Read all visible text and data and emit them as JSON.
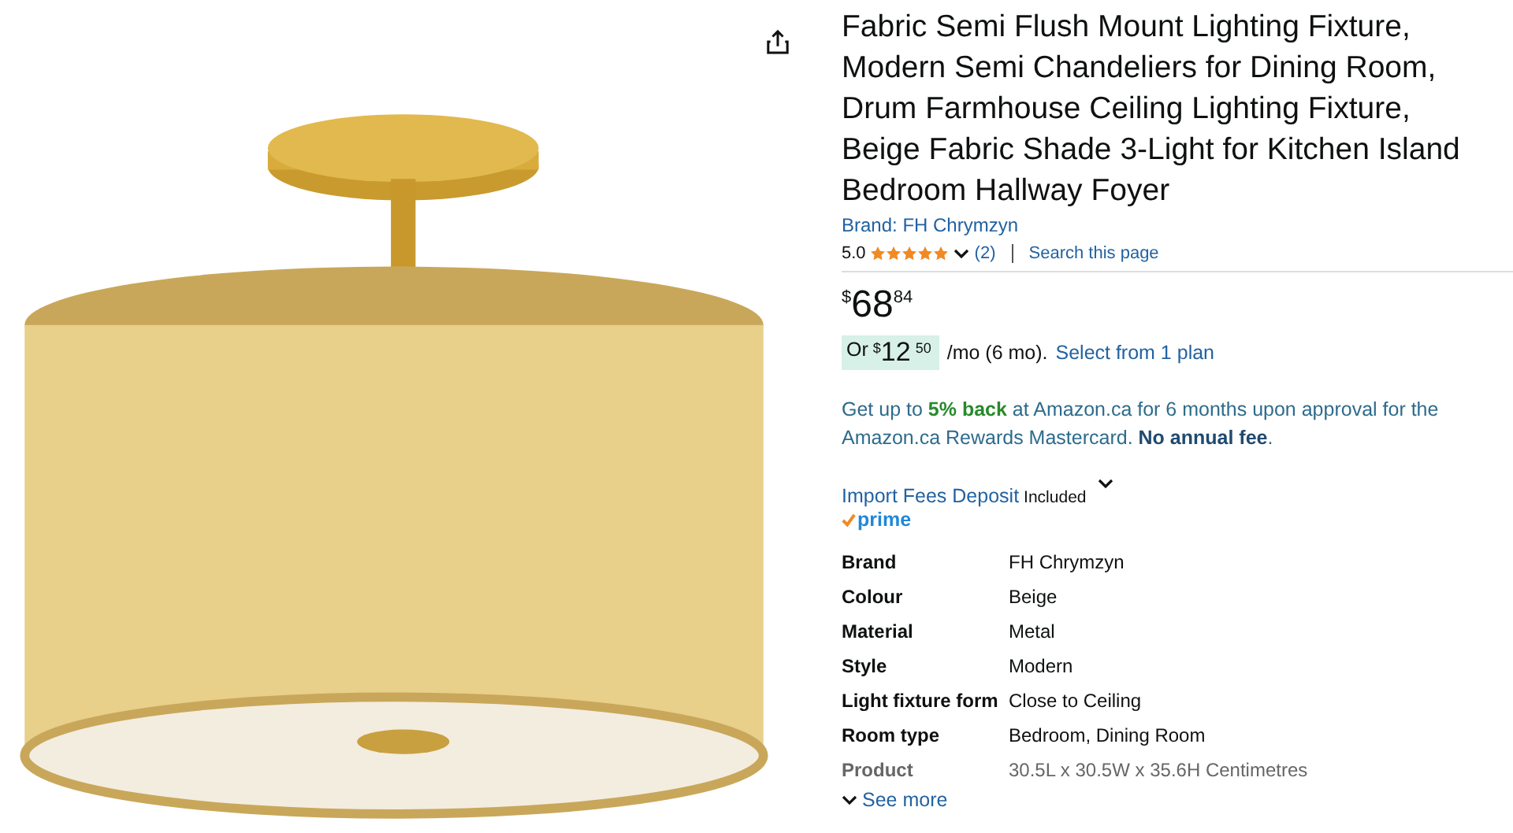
{
  "title": "Fabric Semi Flush Mount Lighting Fixture, Modern Semi Chandeliers for Dining Room, Drum Farmhouse Ceiling Lighting Fixture, Beige Fabric Shade 3-Light for Kitchen Island Bedroom Hallway Foyer",
  "brand_link": "Brand: FH Chrymzyn",
  "rating": {
    "score": "5.0",
    "stars": 5,
    "count": "(2)",
    "search": "Search this page"
  },
  "price": {
    "symbol": "$",
    "whole": "68",
    "fraction": "84"
  },
  "installment": {
    "or": "Or",
    "symbol": "$",
    "whole": "12",
    "fraction": "50",
    "term": "/mo (6 mo).",
    "link": "Select from 1 plan"
  },
  "cashback": "Get up to **5% back** at Amazon.ca for 6 months upon approval for the Amazon.ca Rewards Mastercard. **No annual fee**.",
  "import_fees": {
    "link": "Import Fees Deposit",
    "note": "Included"
  },
  "prime": "prime",
  "specs": [
    {
      "label": "Brand",
      "value": "FH Chrymzyn"
    },
    {
      "label": "Colour",
      "value": "Beige"
    },
    {
      "label": "Material",
      "value": "Metal"
    },
    {
      "label": "Style",
      "value": "Modern"
    },
    {
      "label": "Light fixture form",
      "value": "Close to Ceiling"
    },
    {
      "label": "Room type",
      "value": "Bedroom, Dining Room"
    },
    {
      "label": "Product",
      "value": "30.5L x 30.5W x 35.6H Centimetres"
    }
  ],
  "see_more": "See more"
}
